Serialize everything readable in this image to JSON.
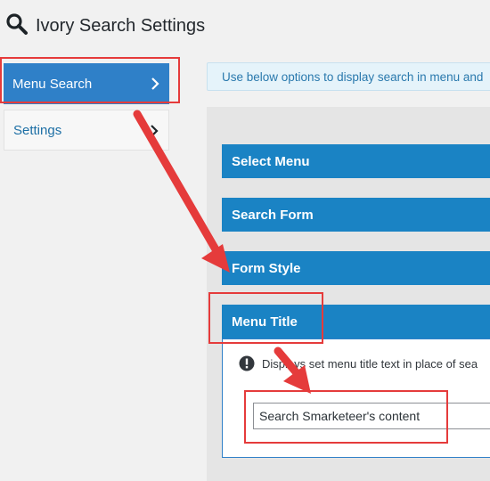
{
  "header": {
    "title": "Ivory Search Settings",
    "icon": "search-icon"
  },
  "sidebar": {
    "items": [
      {
        "label": "Menu Search",
        "active": true
      },
      {
        "label": "Settings",
        "active": false
      }
    ]
  },
  "notice": {
    "text": "Use below options to display search in menu and"
  },
  "sections": [
    {
      "label": "Select Menu"
    },
    {
      "label": "Search Form"
    },
    {
      "label": "Form Style"
    },
    {
      "label": "Menu Title"
    }
  ],
  "menu_title": {
    "hint": "Displays set menu title text in place of sea",
    "input_value": "Search Smarketeer's content"
  },
  "colors": {
    "accent": "#1a83c4",
    "annotation": "#e53b3b",
    "background": "#f1f1f1"
  }
}
